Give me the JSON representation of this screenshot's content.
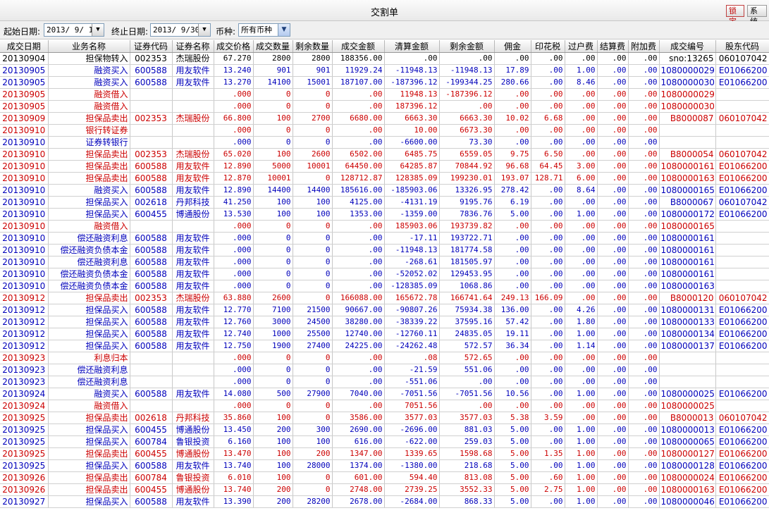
{
  "window": {
    "title": "交割单",
    "lock_label": "锁定",
    "system_label": "系统"
  },
  "filters": {
    "start_label": "起始日期:",
    "start_value": "2013/ 9/ 1",
    "end_label": "终止日期:",
    "end_value": "2013/ 9/30",
    "currency_label": "币种:",
    "currency_value": "所有币种"
  },
  "columns": [
    "成交日期",
    "业务名称",
    "证券代码",
    "证券名称",
    "成交价格",
    "成交数量",
    "剩余数量",
    "成交金额",
    "清算金额",
    "剩余金额",
    "佣金",
    "印花税",
    "过户费",
    "结算费",
    "附加费",
    "成交编号",
    "股东代码"
  ],
  "colors": {
    "buy": "#0000bb",
    "sell": "#cc0000"
  },
  "rows": [
    {
      "t": "black",
      "cells": [
        "20130904",
        "担保物转入",
        "002353",
        "杰瑞股份",
        "67.270",
        "2800",
        "2800",
        "188356.00",
        ".00",
        ".00",
        ".00",
        ".00",
        ".00",
        ".00",
        ".00",
        "sno:13265",
        "060107042"
      ]
    },
    {
      "t": "blue",
      "cells": [
        "20130905",
        "融资买入",
        "600588",
        "用友软件",
        "13.240",
        "901",
        "901",
        "11929.24",
        "-11948.13",
        "-11948.13",
        "17.89",
        ".00",
        "1.00",
        ".00",
        ".00",
        "1080000029",
        "E01066200"
      ]
    },
    {
      "t": "blue",
      "cells": [
        "20130905",
        "融资买入",
        "600588",
        "用友软件",
        "13.270",
        "14100",
        "15001",
        "187107.00",
        "-187396.12",
        "-199344.25",
        "280.66",
        ".00",
        "8.46",
        ".00",
        ".00",
        "1080000030",
        "E01066200"
      ]
    },
    {
      "t": "red",
      "cells": [
        "20130905",
        "融资借入",
        "",
        "",
        ".000",
        "0",
        "0",
        ".00",
        "11948.13",
        "-187396.12",
        ".00",
        ".00",
        ".00",
        ".00",
        ".00",
        "1080000029",
        ""
      ]
    },
    {
      "t": "red",
      "cells": [
        "20130905",
        "融资借入",
        "",
        "",
        ".000",
        "0",
        "0",
        ".00",
        "187396.12",
        ".00",
        ".00",
        ".00",
        ".00",
        ".00",
        ".00",
        "1080000030",
        ""
      ]
    },
    {
      "t": "red",
      "cells": [
        "20130909",
        "担保品卖出",
        "002353",
        "杰瑞股份",
        "66.800",
        "100",
        "2700",
        "6680.00",
        "6663.30",
        "6663.30",
        "10.02",
        "6.68",
        ".00",
        ".00",
        ".00",
        "B8000087",
        "060107042"
      ]
    },
    {
      "t": "red",
      "cells": [
        "20130910",
        "银行转证券",
        "",
        "",
        ".000",
        "0",
        "0",
        ".00",
        "10.00",
        "6673.30",
        ".00",
        ".00",
        ".00",
        ".00",
        ".00",
        "",
        ""
      ]
    },
    {
      "t": "blue",
      "cells": [
        "20130910",
        "证券转银行",
        "",
        "",
        ".000",
        "0",
        "0",
        ".00",
        "-6600.00",
        "73.30",
        ".00",
        ".00",
        ".00",
        ".00",
        ".00",
        "",
        ""
      ]
    },
    {
      "t": "red",
      "cells": [
        "20130910",
        "担保品卖出",
        "002353",
        "杰瑞股份",
        "65.020",
        "100",
        "2600",
        "6502.00",
        "6485.75",
        "6559.05",
        "9.75",
        "6.50",
        ".00",
        ".00",
        ".00",
        "B8000054",
        "060107042"
      ]
    },
    {
      "t": "red",
      "cells": [
        "20130910",
        "担保品卖出",
        "600588",
        "用友软件",
        "12.890",
        "5000",
        "10001",
        "64450.00",
        "64285.87",
        "70844.92",
        "96.68",
        "64.45",
        "3.00",
        ".00",
        ".00",
        "1080000161",
        "E01066200"
      ]
    },
    {
      "t": "red",
      "cells": [
        "20130910",
        "担保品卖出",
        "600588",
        "用友软件",
        "12.870",
        "10001",
        "0",
        "128712.87",
        "128385.09",
        "199230.01",
        "193.07",
        "128.71",
        "6.00",
        ".00",
        ".00",
        "1080000163",
        "E01066200"
      ]
    },
    {
      "t": "blue",
      "cells": [
        "20130910",
        "融资买入",
        "600588",
        "用友软件",
        "12.890",
        "14400",
        "14400",
        "185616.00",
        "-185903.06",
        "13326.95",
        "278.42",
        ".00",
        "8.64",
        ".00",
        ".00",
        "1080000165",
        "E01066200"
      ]
    },
    {
      "t": "blue",
      "cells": [
        "20130910",
        "担保品买入",
        "002618",
        "丹邦科技",
        "41.250",
        "100",
        "100",
        "4125.00",
        "-4131.19",
        "9195.76",
        "6.19",
        ".00",
        ".00",
        ".00",
        ".00",
        "B8000067",
        "060107042"
      ]
    },
    {
      "t": "blue",
      "cells": [
        "20130910",
        "担保品买入",
        "600455",
        "博通股份",
        "13.530",
        "100",
        "100",
        "1353.00",
        "-1359.00",
        "7836.76",
        "5.00",
        ".00",
        "1.00",
        ".00",
        ".00",
        "1080000172",
        "E01066200"
      ]
    },
    {
      "t": "red",
      "cells": [
        "20130910",
        "融资借入",
        "",
        "",
        ".000",
        "0",
        "0",
        ".00",
        "185903.06",
        "193739.82",
        ".00",
        ".00",
        ".00",
        ".00",
        ".00",
        "1080000165",
        ""
      ]
    },
    {
      "t": "blue",
      "cells": [
        "20130910",
        "偿还融资利息",
        "600588",
        "用友软件",
        ".000",
        "0",
        "0",
        ".00",
        "-17.11",
        "193722.71",
        ".00",
        ".00",
        ".00",
        ".00",
        ".00",
        "1080000161",
        ""
      ]
    },
    {
      "t": "blue",
      "cells": [
        "20130910",
        "偿还融资负债本金",
        "600588",
        "用友软件",
        ".000",
        "0",
        "0",
        ".00",
        "-11948.13",
        "181774.58",
        ".00",
        ".00",
        ".00",
        ".00",
        ".00",
        "1080000161",
        ""
      ]
    },
    {
      "t": "blue",
      "cells": [
        "20130910",
        "偿还融资利息",
        "600588",
        "用友软件",
        ".000",
        "0",
        "0",
        ".00",
        "-268.61",
        "181505.97",
        ".00",
        ".00",
        ".00",
        ".00",
        ".00",
        "1080000161",
        ""
      ]
    },
    {
      "t": "blue",
      "cells": [
        "20130910",
        "偿还融资负债本金",
        "600588",
        "用友软件",
        ".000",
        "0",
        "0",
        ".00",
        "-52052.02",
        "129453.95",
        ".00",
        ".00",
        ".00",
        ".00",
        ".00",
        "1080000161",
        ""
      ]
    },
    {
      "t": "blue",
      "cells": [
        "20130910",
        "偿还融资负债本金",
        "600588",
        "用友软件",
        ".000",
        "0",
        "0",
        ".00",
        "-128385.09",
        "1068.86",
        ".00",
        ".00",
        ".00",
        ".00",
        ".00",
        "1080000163",
        ""
      ]
    },
    {
      "t": "red",
      "cells": [
        "20130912",
        "担保品卖出",
        "002353",
        "杰瑞股份",
        "63.880",
        "2600",
        "0",
        "166088.00",
        "165672.78",
        "166741.64",
        "249.13",
        "166.09",
        ".00",
        ".00",
        ".00",
        "B8000120",
        "060107042"
      ]
    },
    {
      "t": "blue",
      "cells": [
        "20130912",
        "担保品买入",
        "600588",
        "用友软件",
        "12.770",
        "7100",
        "21500",
        "90667.00",
        "-90807.26",
        "75934.38",
        "136.00",
        ".00",
        "4.26",
        ".00",
        ".00",
        "1080000131",
        "E01066200"
      ]
    },
    {
      "t": "blue",
      "cells": [
        "20130912",
        "担保品买入",
        "600588",
        "用友软件",
        "12.760",
        "3000",
        "24500",
        "38280.00",
        "-38339.22",
        "37595.16",
        "57.42",
        ".00",
        "1.80",
        ".00",
        ".00",
        "1080000133",
        "E01066200"
      ]
    },
    {
      "t": "blue",
      "cells": [
        "20130912",
        "担保品买入",
        "600588",
        "用友软件",
        "12.740",
        "1000",
        "25500",
        "12740.00",
        "-12760.11",
        "24835.05",
        "19.11",
        ".00",
        "1.00",
        ".00",
        ".00",
        "1080000134",
        "E01066200"
      ]
    },
    {
      "t": "blue",
      "cells": [
        "20130912",
        "担保品买入",
        "600588",
        "用友软件",
        "12.750",
        "1900",
        "27400",
        "24225.00",
        "-24262.48",
        "572.57",
        "36.34",
        ".00",
        "1.14",
        ".00",
        ".00",
        "1080000137",
        "E01066200"
      ]
    },
    {
      "t": "red",
      "cells": [
        "20130923",
        "利息归本",
        "",
        "",
        ".000",
        "0",
        "0",
        ".00",
        ".08",
        "572.65",
        ".00",
        ".00",
        ".00",
        ".00",
        ".00",
        "",
        ""
      ]
    },
    {
      "t": "blue",
      "cells": [
        "20130923",
        "偿还融资利息",
        "",
        "",
        ".000",
        "0",
        "0",
        ".00",
        "-21.59",
        "551.06",
        ".00",
        ".00",
        ".00",
        ".00",
        ".00",
        "",
        ""
      ]
    },
    {
      "t": "blue",
      "cells": [
        "20130923",
        "偿还融资利息",
        "",
        "",
        ".000",
        "0",
        "0",
        ".00",
        "-551.06",
        ".00",
        ".00",
        ".00",
        ".00",
        ".00",
        ".00",
        "",
        ""
      ]
    },
    {
      "t": "blue",
      "cells": [
        "20130924",
        "融资买入",
        "600588",
        "用友软件",
        "14.080",
        "500",
        "27900",
        "7040.00",
        "-7051.56",
        "-7051.56",
        "10.56",
        ".00",
        "1.00",
        ".00",
        ".00",
        "1080000025",
        "E01066200"
      ]
    },
    {
      "t": "red",
      "cells": [
        "20130924",
        "融资借入",
        "",
        "",
        ".000",
        "0",
        "0",
        ".00",
        "7051.56",
        ".00",
        ".00",
        ".00",
        ".00",
        ".00",
        ".00",
        "1080000025",
        ""
      ]
    },
    {
      "t": "red",
      "cells": [
        "20130925",
        "担保品卖出",
        "002618",
        "丹邦科技",
        "35.860",
        "100",
        "0",
        "3586.00",
        "3577.03",
        "3577.03",
        "5.38",
        "3.59",
        ".00",
        ".00",
        ".00",
        "B8000013",
        "060107042"
      ]
    },
    {
      "t": "blue",
      "cells": [
        "20130925",
        "担保品买入",
        "600455",
        "博通股份",
        "13.450",
        "200",
        "300",
        "2690.00",
        "-2696.00",
        "881.03",
        "5.00",
        ".00",
        "1.00",
        ".00",
        ".00",
        "1080000013",
        "E01066200"
      ]
    },
    {
      "t": "blue",
      "cells": [
        "20130925",
        "担保品买入",
        "600784",
        "鲁银投资",
        "6.160",
        "100",
        "100",
        "616.00",
        "-622.00",
        "259.03",
        "5.00",
        ".00",
        "1.00",
        ".00",
        ".00",
        "1080000065",
        "E01066200"
      ]
    },
    {
      "t": "red",
      "cells": [
        "20130925",
        "担保品卖出",
        "600455",
        "博通股份",
        "13.470",
        "100",
        "200",
        "1347.00",
        "1339.65",
        "1598.68",
        "5.00",
        "1.35",
        "1.00",
        ".00",
        ".00",
        "1080000127",
        "E01066200"
      ]
    },
    {
      "t": "blue",
      "cells": [
        "20130925",
        "担保品买入",
        "600588",
        "用友软件",
        "13.740",
        "100",
        "28000",
        "1374.00",
        "-1380.00",
        "218.68",
        "5.00",
        ".00",
        "1.00",
        ".00",
        ".00",
        "1080000128",
        "E01066200"
      ]
    },
    {
      "t": "red",
      "cells": [
        "20130926",
        "担保品卖出",
        "600784",
        "鲁银投资",
        "6.010",
        "100",
        "0",
        "601.00",
        "594.40",
        "813.08",
        "5.00",
        ".60",
        "1.00",
        ".00",
        ".00",
        "1080000024",
        "E01066200"
      ]
    },
    {
      "t": "red",
      "cells": [
        "20130926",
        "担保品卖出",
        "600455",
        "博通股份",
        "13.740",
        "200",
        "0",
        "2748.00",
        "2739.25",
        "3552.33",
        "5.00",
        "2.75",
        "1.00",
        ".00",
        ".00",
        "1080000163",
        "E01066200"
      ]
    },
    {
      "t": "blue",
      "cells": [
        "20130927",
        "担保品买入",
        "600588",
        "用友软件",
        "13.390",
        "200",
        "28200",
        "2678.00",
        "-2684.00",
        "868.33",
        "5.00",
        ".00",
        "1.00",
        ".00",
        ".00",
        "1080000046",
        "E01066200"
      ]
    }
  ]
}
